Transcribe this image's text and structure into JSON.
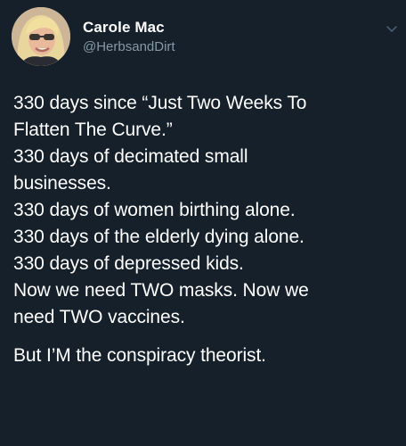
{
  "author": {
    "display_name": "Carole Mac",
    "handle": "@HerbsandDirt"
  },
  "icons": {
    "avatar": "profile-photo",
    "menu": "chevron-down-icon"
  },
  "tweet_lines": [
    "330 days since “Just Two Weeks To",
    "Flatten The Curve.”",
    "330 days of decimated small",
    "businesses.",
    "330 days of women birthing alone.",
    "330 days of the elderly dying alone.",
    "330 days of depressed kids.",
    "Now we need TWO masks. Now we",
    "need TWO vaccines."
  ],
  "tweet_last_line": "But I’M the conspiracy theorist.",
  "colors": {
    "background": "#15202b",
    "text": "#ffffff",
    "secondary": "#8899a6"
  }
}
